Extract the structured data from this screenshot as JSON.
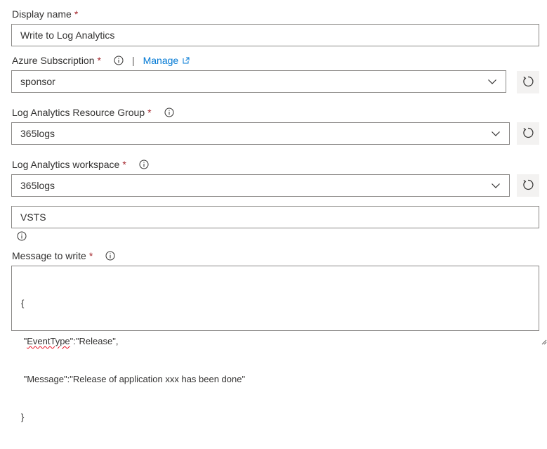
{
  "fields": {
    "display_name": {
      "label": "Display name",
      "required_mark": "*",
      "value": "Write to Log Analytics"
    },
    "azure_subscription": {
      "label": "Azure Subscription",
      "required_mark": "*",
      "separator": "|",
      "manage_link": "Manage",
      "value": "sponsor"
    },
    "resource_group": {
      "label": "Log Analytics Resource Group",
      "required_mark": "*",
      "value": "365logs"
    },
    "workspace": {
      "label": "Log Analytics workspace",
      "required_mark": "*",
      "value": "365logs"
    },
    "extra_field": {
      "value": "VSTS"
    },
    "message": {
      "label": "Message to write",
      "required_mark": "*",
      "lines": {
        "l1": "{",
        "l2_pre": " \"",
        "l2_word": "EventType",
        "l2_post": "\":\"Release\",",
        "l3": " \"Message\":\"Release of application xxx has been done\"",
        "l4": "}"
      }
    }
  },
  "icons": {
    "info": "info-icon",
    "refresh": "refresh-icon",
    "chevron": "chevron-down-icon",
    "external": "external-link-icon"
  },
  "colors": {
    "link": "#0078d4",
    "required": "#a4262c",
    "border": "#8a8886",
    "button_bg": "#f3f2f1"
  }
}
